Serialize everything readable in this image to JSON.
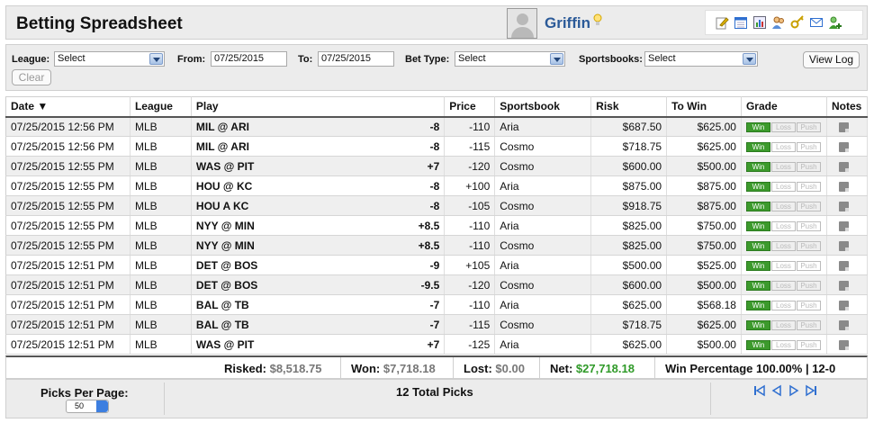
{
  "header": {
    "title": "Betting Spreadsheet",
    "username": "Griffin",
    "icons": [
      "edit-icon",
      "calendar-icon",
      "chart-icon",
      "users-icon",
      "key-icon",
      "mail-icon",
      "add-user-icon"
    ]
  },
  "filters": {
    "league_label": "League:",
    "league_value": "Select",
    "from_label": "From:",
    "from_value": "07/25/2015",
    "to_label": "To:",
    "to_value": "07/25/2015",
    "bettype_label": "Bet Type:",
    "bettype_value": "Select",
    "sportsbooks_label": "Sportsbooks:",
    "sportsbooks_value": "Select",
    "clear_label": "Clear",
    "viewlog_label": "View Log"
  },
  "table": {
    "headers": [
      "Date ▼",
      "League",
      "Play",
      "Price",
      "Sportsbook",
      "Risk",
      "To Win",
      "Grade",
      "Notes"
    ],
    "grade_labels": [
      "Win",
      "Loss",
      "Push"
    ],
    "rows": [
      {
        "date": "07/25/2015 12:56 PM",
        "league": "MLB",
        "play": "MIL @ ARI",
        "spread": "-8",
        "price": "-110",
        "book": "Aria",
        "risk": "$687.50",
        "towin": "$625.00"
      },
      {
        "date": "07/25/2015 12:56 PM",
        "league": "MLB",
        "play": "MIL @ ARI",
        "spread": "-8",
        "price": "-115",
        "book": "Cosmo",
        "risk": "$718.75",
        "towin": "$625.00"
      },
      {
        "date": "07/25/2015 12:55 PM",
        "league": "MLB",
        "play": "WAS @ PIT",
        "spread": "+7",
        "price": "-120",
        "book": "Cosmo",
        "risk": "$600.00",
        "towin": "$500.00"
      },
      {
        "date": "07/25/2015 12:55 PM",
        "league": "MLB",
        "play": "HOU @ KC",
        "spread": "-8",
        "price": "+100",
        "book": "Aria",
        "risk": "$875.00",
        "towin": "$875.00"
      },
      {
        "date": "07/25/2015 12:55 PM",
        "league": "MLB",
        "play": "HOU A KC",
        "spread": "-8",
        "price": "-105",
        "book": "Cosmo",
        "risk": "$918.75",
        "towin": "$875.00"
      },
      {
        "date": "07/25/2015 12:55 PM",
        "league": "MLB",
        "play": "NYY @ MIN",
        "spread": "+8.5",
        "price": "-110",
        "book": "Aria",
        "risk": "$825.00",
        "towin": "$750.00"
      },
      {
        "date": "07/25/2015 12:55 PM",
        "league": "MLB",
        "play": "NYY @ MIN",
        "spread": "+8.5",
        "price": "-110",
        "book": "Cosmo",
        "risk": "$825.00",
        "towin": "$750.00"
      },
      {
        "date": "07/25/2015 12:51 PM",
        "league": "MLB",
        "play": "DET @ BOS",
        "spread": "-9",
        "price": "+105",
        "book": "Aria",
        "risk": "$500.00",
        "towin": "$525.00"
      },
      {
        "date": "07/25/2015 12:51 PM",
        "league": "MLB",
        "play": "DET @ BOS",
        "spread": "-9.5",
        "price": "-120",
        "book": "Cosmo",
        "risk": "$600.00",
        "towin": "$500.00"
      },
      {
        "date": "07/25/2015 12:51 PM",
        "league": "MLB",
        "play": "BAL @ TB",
        "spread": "-7",
        "price": "-110",
        "book": "Aria",
        "risk": "$625.00",
        "towin": "$568.18"
      },
      {
        "date": "07/25/2015 12:51 PM",
        "league": "MLB",
        "play": "BAL @ TB",
        "spread": "-7",
        "price": "-115",
        "book": "Cosmo",
        "risk": "$718.75",
        "towin": "$625.00"
      },
      {
        "date": "07/25/2015 12:51 PM",
        "league": "MLB",
        "play": "WAS @ PIT",
        "spread": "+7",
        "price": "-125",
        "book": "Aria",
        "risk": "$625.00",
        "towin": "$500.00"
      }
    ]
  },
  "totals": {
    "risked_label": "Risked:",
    "risked": "$8,518.75",
    "won_label": "Won:",
    "won": "$7,718.18",
    "lost_label": "Lost:",
    "lost": "$0.00",
    "net_label": "Net:",
    "net": "$27,718.18",
    "winpct": "Win Percentage 100.00% | 12-0"
  },
  "footer": {
    "picks_per_page_label": "Picks Per Page:",
    "picks_per_page": "50",
    "total_picks": "12 Total Picks"
  },
  "colors": {
    "win": "#3c9a2c",
    "net": "#2f9a28",
    "link": "#2b5a98",
    "pager": "#2f6fd0"
  }
}
